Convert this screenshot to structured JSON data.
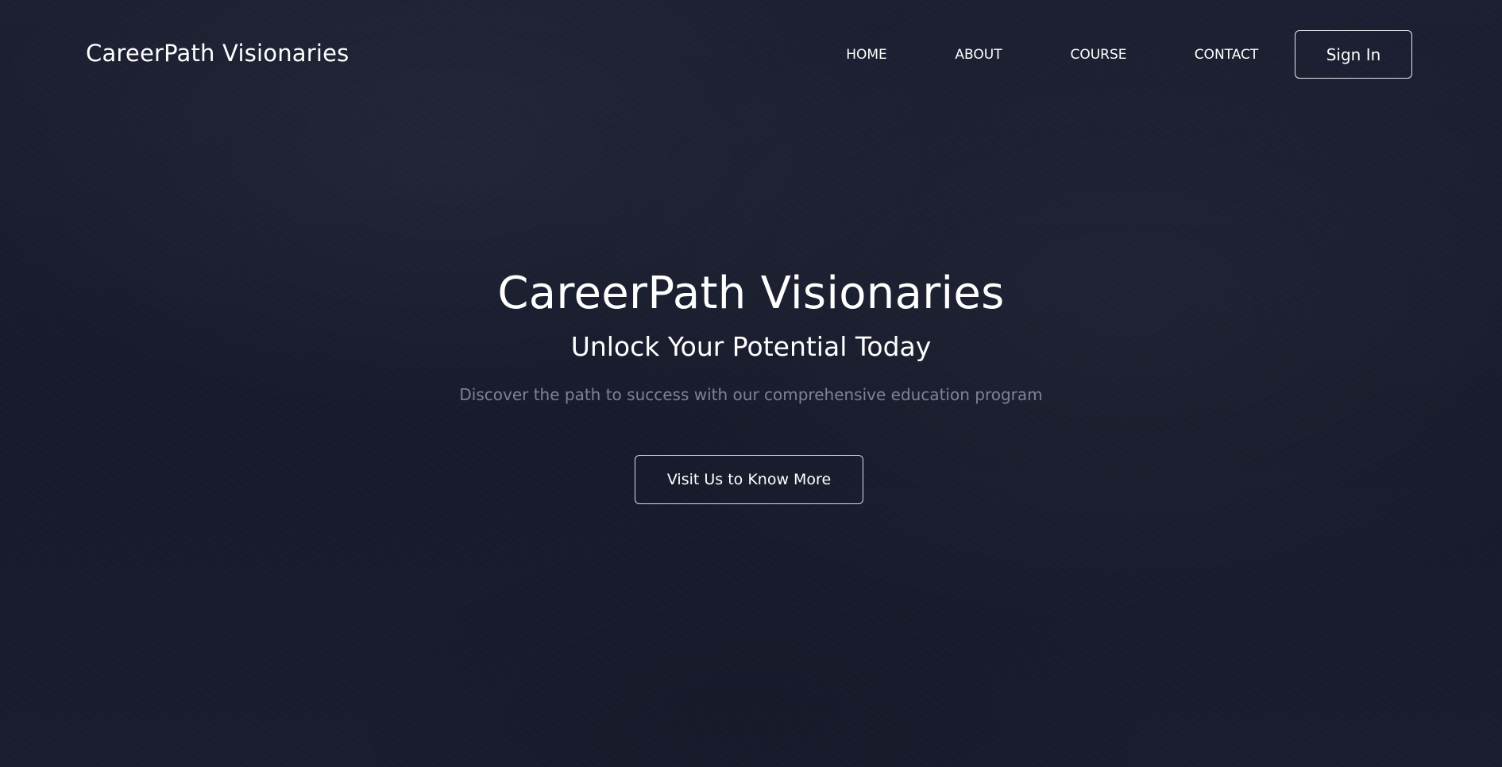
{
  "header": {
    "brand": "CareerPath Visionaries",
    "nav": {
      "home": "HOME",
      "about": "ABOUT",
      "course": "COURSE",
      "contact": "CONTACT"
    },
    "sign_in_label": "Sign In"
  },
  "hero": {
    "title": "CareerPath Visionaries",
    "subtitle": "Unlock Your Potential Today",
    "description": "Discover the path to success with our comprehensive education program",
    "cta_label": "Visit Us to Know More"
  },
  "colors": {
    "background": "#181c2e",
    "text": "#ffffff",
    "muted_text": "#7d8294",
    "button_border": "#e6e8ee"
  }
}
